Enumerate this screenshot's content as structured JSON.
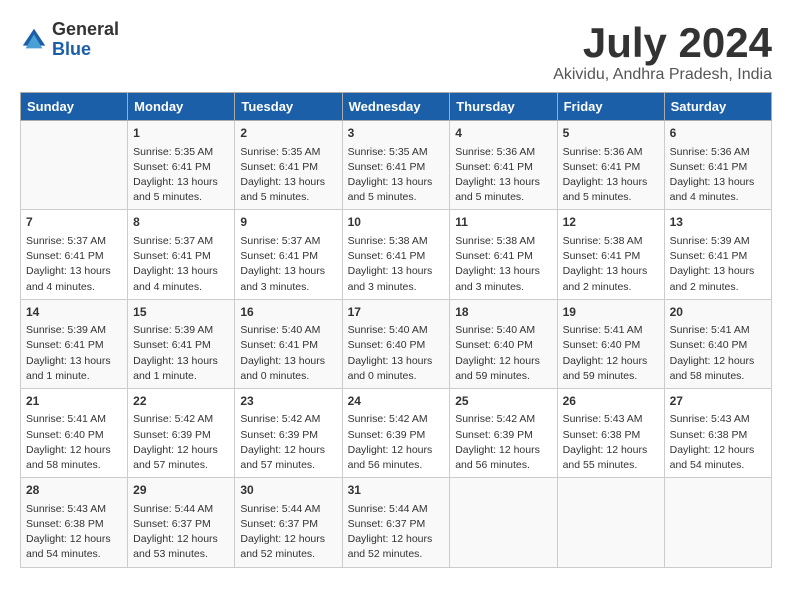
{
  "logo": {
    "general": "General",
    "blue": "Blue"
  },
  "title": "July 2024",
  "subtitle": "Akividu, Andhra Pradesh, India",
  "headers": [
    "Sunday",
    "Monday",
    "Tuesday",
    "Wednesday",
    "Thursday",
    "Friday",
    "Saturday"
  ],
  "weeks": [
    [
      {
        "day": "",
        "lines": []
      },
      {
        "day": "1",
        "lines": [
          "Sunrise: 5:35 AM",
          "Sunset: 6:41 PM",
          "Daylight: 13 hours",
          "and 5 minutes."
        ]
      },
      {
        "day": "2",
        "lines": [
          "Sunrise: 5:35 AM",
          "Sunset: 6:41 PM",
          "Daylight: 13 hours",
          "and 5 minutes."
        ]
      },
      {
        "day": "3",
        "lines": [
          "Sunrise: 5:35 AM",
          "Sunset: 6:41 PM",
          "Daylight: 13 hours",
          "and 5 minutes."
        ]
      },
      {
        "day": "4",
        "lines": [
          "Sunrise: 5:36 AM",
          "Sunset: 6:41 PM",
          "Daylight: 13 hours",
          "and 5 minutes."
        ]
      },
      {
        "day": "5",
        "lines": [
          "Sunrise: 5:36 AM",
          "Sunset: 6:41 PM",
          "Daylight: 13 hours",
          "and 5 minutes."
        ]
      },
      {
        "day": "6",
        "lines": [
          "Sunrise: 5:36 AM",
          "Sunset: 6:41 PM",
          "Daylight: 13 hours",
          "and 4 minutes."
        ]
      }
    ],
    [
      {
        "day": "7",
        "lines": [
          "Sunrise: 5:37 AM",
          "Sunset: 6:41 PM",
          "Daylight: 13 hours",
          "and 4 minutes."
        ]
      },
      {
        "day": "8",
        "lines": [
          "Sunrise: 5:37 AM",
          "Sunset: 6:41 PM",
          "Daylight: 13 hours",
          "and 4 minutes."
        ]
      },
      {
        "day": "9",
        "lines": [
          "Sunrise: 5:37 AM",
          "Sunset: 6:41 PM",
          "Daylight: 13 hours",
          "and 3 minutes."
        ]
      },
      {
        "day": "10",
        "lines": [
          "Sunrise: 5:38 AM",
          "Sunset: 6:41 PM",
          "Daylight: 13 hours",
          "and 3 minutes."
        ]
      },
      {
        "day": "11",
        "lines": [
          "Sunrise: 5:38 AM",
          "Sunset: 6:41 PM",
          "Daylight: 13 hours",
          "and 3 minutes."
        ]
      },
      {
        "day": "12",
        "lines": [
          "Sunrise: 5:38 AM",
          "Sunset: 6:41 PM",
          "Daylight: 13 hours",
          "and 2 minutes."
        ]
      },
      {
        "day": "13",
        "lines": [
          "Sunrise: 5:39 AM",
          "Sunset: 6:41 PM",
          "Daylight: 13 hours",
          "and 2 minutes."
        ]
      }
    ],
    [
      {
        "day": "14",
        "lines": [
          "Sunrise: 5:39 AM",
          "Sunset: 6:41 PM",
          "Daylight: 13 hours",
          "and 1 minute."
        ]
      },
      {
        "day": "15",
        "lines": [
          "Sunrise: 5:39 AM",
          "Sunset: 6:41 PM",
          "Daylight: 13 hours",
          "and 1 minute."
        ]
      },
      {
        "day": "16",
        "lines": [
          "Sunrise: 5:40 AM",
          "Sunset: 6:41 PM",
          "Daylight: 13 hours",
          "and 0 minutes."
        ]
      },
      {
        "day": "17",
        "lines": [
          "Sunrise: 5:40 AM",
          "Sunset: 6:40 PM",
          "Daylight: 13 hours",
          "and 0 minutes."
        ]
      },
      {
        "day": "18",
        "lines": [
          "Sunrise: 5:40 AM",
          "Sunset: 6:40 PM",
          "Daylight: 12 hours",
          "and 59 minutes."
        ]
      },
      {
        "day": "19",
        "lines": [
          "Sunrise: 5:41 AM",
          "Sunset: 6:40 PM",
          "Daylight: 12 hours",
          "and 59 minutes."
        ]
      },
      {
        "day": "20",
        "lines": [
          "Sunrise: 5:41 AM",
          "Sunset: 6:40 PM",
          "Daylight: 12 hours",
          "and 58 minutes."
        ]
      }
    ],
    [
      {
        "day": "21",
        "lines": [
          "Sunrise: 5:41 AM",
          "Sunset: 6:40 PM",
          "Daylight: 12 hours",
          "and 58 minutes."
        ]
      },
      {
        "day": "22",
        "lines": [
          "Sunrise: 5:42 AM",
          "Sunset: 6:39 PM",
          "Daylight: 12 hours",
          "and 57 minutes."
        ]
      },
      {
        "day": "23",
        "lines": [
          "Sunrise: 5:42 AM",
          "Sunset: 6:39 PM",
          "Daylight: 12 hours",
          "and 57 minutes."
        ]
      },
      {
        "day": "24",
        "lines": [
          "Sunrise: 5:42 AM",
          "Sunset: 6:39 PM",
          "Daylight: 12 hours",
          "and 56 minutes."
        ]
      },
      {
        "day": "25",
        "lines": [
          "Sunrise: 5:42 AM",
          "Sunset: 6:39 PM",
          "Daylight: 12 hours",
          "and 56 minutes."
        ]
      },
      {
        "day": "26",
        "lines": [
          "Sunrise: 5:43 AM",
          "Sunset: 6:38 PM",
          "Daylight: 12 hours",
          "and 55 minutes."
        ]
      },
      {
        "day": "27",
        "lines": [
          "Sunrise: 5:43 AM",
          "Sunset: 6:38 PM",
          "Daylight: 12 hours",
          "and 54 minutes."
        ]
      }
    ],
    [
      {
        "day": "28",
        "lines": [
          "Sunrise: 5:43 AM",
          "Sunset: 6:38 PM",
          "Daylight: 12 hours",
          "and 54 minutes."
        ]
      },
      {
        "day": "29",
        "lines": [
          "Sunrise: 5:44 AM",
          "Sunset: 6:37 PM",
          "Daylight: 12 hours",
          "and 53 minutes."
        ]
      },
      {
        "day": "30",
        "lines": [
          "Sunrise: 5:44 AM",
          "Sunset: 6:37 PM",
          "Daylight: 12 hours",
          "and 52 minutes."
        ]
      },
      {
        "day": "31",
        "lines": [
          "Sunrise: 5:44 AM",
          "Sunset: 6:37 PM",
          "Daylight: 12 hours",
          "and 52 minutes."
        ]
      },
      {
        "day": "",
        "lines": []
      },
      {
        "day": "",
        "lines": []
      },
      {
        "day": "",
        "lines": []
      }
    ]
  ]
}
